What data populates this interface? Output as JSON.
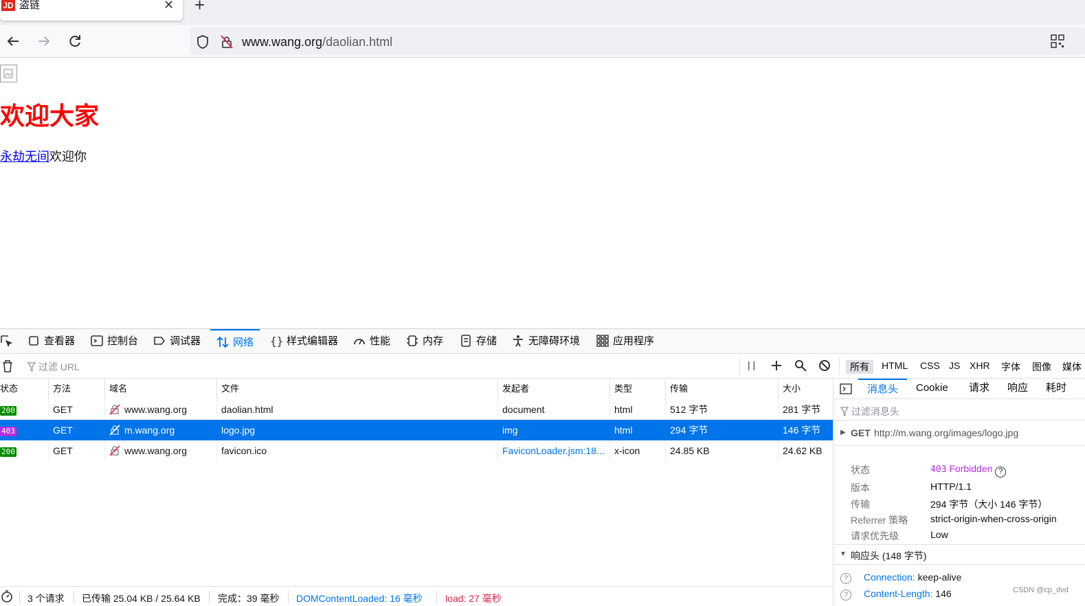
{
  "tab": {
    "favicon_text": "JD",
    "title": "盗链",
    "close_glyph": "✕",
    "new_tab_glyph": "+"
  },
  "navbar": {
    "url_host": "www.wang.org",
    "url_path": "/daolian.html"
  },
  "page": {
    "heading": "欢迎大家",
    "link_text": "永劫无间",
    "after_link": "欢迎你"
  },
  "devtools": {
    "tabs": [
      {
        "label": "查看器",
        "icon": "inspector-icon"
      },
      {
        "label": "控制台",
        "icon": "console-icon"
      },
      {
        "label": "调试器",
        "icon": "debugger-icon"
      },
      {
        "label": "网络",
        "icon": "network-icon"
      },
      {
        "label": "样式编辑器",
        "icon": "style-editor-icon"
      },
      {
        "label": "性能",
        "icon": "performance-icon"
      },
      {
        "label": "内存",
        "icon": "memory-icon"
      },
      {
        "label": "存储",
        "icon": "storage-icon"
      },
      {
        "label": "无障碍环境",
        "icon": "accessibility-icon"
      },
      {
        "label": "应用程序",
        "icon": "application-icon"
      }
    ],
    "filter_placeholder": "过滤 URL",
    "pause_glyph": "| |",
    "type_filters": [
      "所有",
      "HTML",
      "CSS",
      "JS",
      "XHR",
      "字体",
      "图像",
      "媒体"
    ],
    "columns": [
      "状态",
      "方法",
      "域名",
      "文件",
      "发起者",
      "类型",
      "传输",
      "大小"
    ],
    "rows": [
      {
        "status": "200",
        "status_color": "#058b00",
        "method": "GET",
        "domain": "www.wang.org",
        "file": "daolian.html",
        "initiator": "document",
        "type": "html",
        "transferred": "512 字节",
        "size": "281 字节"
      },
      {
        "status": "403",
        "status_color": "#b72ee0",
        "method": "GET",
        "domain": "m.wang.org",
        "file": "logo.jpg",
        "initiator": "img",
        "type": "html",
        "transferred": "294 字节",
        "size": "146 字节"
      },
      {
        "status": "200",
        "status_color": "#058b00",
        "method": "GET",
        "domain": "www.wang.org",
        "file": "favicon.ico",
        "initiator": "FaviconLoader.jsm:18...",
        "type": "x-icon",
        "transferred": "24.85 KB",
        "size": "24.62 KB"
      }
    ],
    "status_bar": {
      "requests": "3 个请求",
      "transferred": "已传输 25.04 KB / 25.64 KB",
      "finish": "完成：39 毫秒",
      "dom_loaded": "DOMContentLoaded: 16 毫秒",
      "load": "load: 27 毫秒"
    },
    "side": {
      "tabs": [
        "消息头",
        "Cookie",
        "请求",
        "响应",
        "耗时"
      ],
      "filter_placeholder": "过滤消息头",
      "request_method": "GET",
      "request_url": "http://m.wang.org/images/logo.jpg",
      "details": [
        {
          "key": "状态",
          "value": "Forbidden",
          "code": "403"
        },
        {
          "key": "版本",
          "value": "HTTP/1.1"
        },
        {
          "key": "传输",
          "value": "294 字节（大小 146 字节）"
        },
        {
          "key": "Referrer 策略",
          "value": "strict-origin-when-cross-origin"
        },
        {
          "key": "请求优先级",
          "value": "Low"
        }
      ],
      "response_headers_title": "响应头 (148 字节)",
      "response_headers": [
        {
          "name": "Connection:",
          "value": "keep-alive"
        },
        {
          "name": "Content-Length:",
          "value": "146"
        }
      ]
    }
  },
  "watermark": "CSDN @cp_dvd"
}
